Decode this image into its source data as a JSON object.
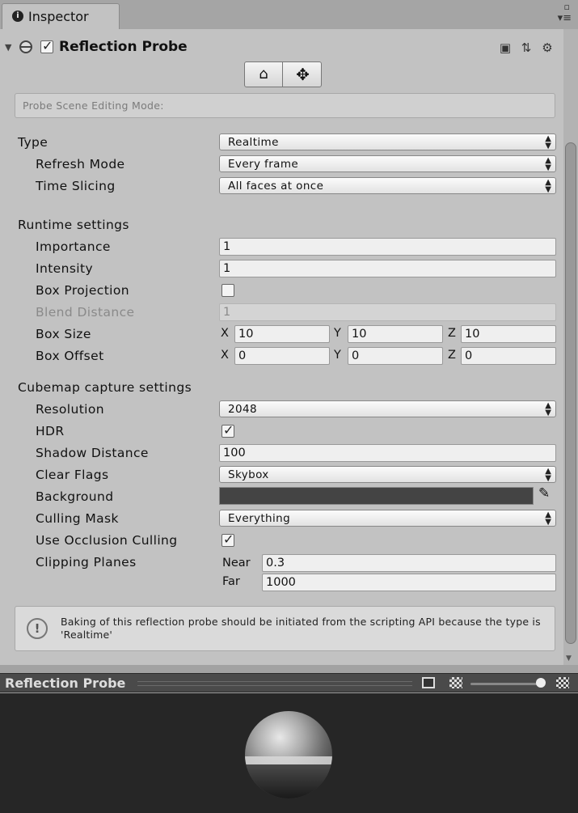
{
  "window": {
    "tab_title": "Inspector"
  },
  "component": {
    "title": "Reflection Probe",
    "enabled": true,
    "editing_mode_label": "Probe Scene Editing Mode:"
  },
  "type_section": {
    "type_label": "Type",
    "type_value": "Realtime",
    "refresh_label": "Refresh Mode",
    "refresh_value": "Every frame",
    "slicing_label": "Time Slicing",
    "slicing_value": "All faces at once"
  },
  "runtime": {
    "header": "Runtime settings",
    "importance_label": "Importance",
    "importance_value": "1",
    "intensity_label": "Intensity",
    "intensity_value": "1",
    "box_projection_label": "Box Projection",
    "box_projection": false,
    "blend_label": "Blend Distance",
    "blend_value": "1",
    "box_size_label": "Box Size",
    "box_size": {
      "x": "10",
      "y": "10",
      "z": "10"
    },
    "box_offset_label": "Box Offset",
    "box_offset": {
      "x": "0",
      "y": "0",
      "z": "0"
    },
    "axis": {
      "x": "X",
      "y": "Y",
      "z": "Z"
    }
  },
  "cubemap": {
    "header": "Cubemap capture settings",
    "resolution_label": "Resolution",
    "resolution_value": "2048",
    "hdr_label": "HDR",
    "hdr": true,
    "shadow_label": "Shadow Distance",
    "shadow_value": "100",
    "clear_label": "Clear Flags",
    "clear_value": "Skybox",
    "background_label": "Background",
    "background_color": "#444444",
    "culling_label": "Culling Mask",
    "culling_value": "Everything",
    "occlusion_label": "Use Occlusion Culling",
    "occlusion": true,
    "clipping_label": "Clipping Planes",
    "near_label": "Near",
    "near_value": "0.3",
    "far_label": "Far",
    "far_value": "1000"
  },
  "help": {
    "text": "Baking of this reflection probe should be initiated from the scripting API because the type is 'Realtime'"
  },
  "preview": {
    "title": "Reflection Probe"
  }
}
